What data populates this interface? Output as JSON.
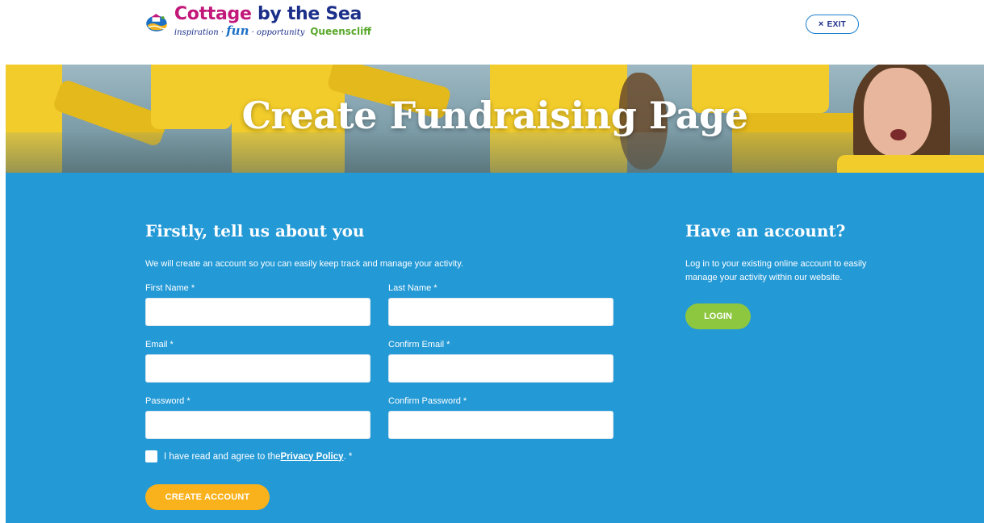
{
  "header": {
    "logo_title_part1": "Cottage",
    "logo_title_part2": "by the Sea",
    "logo_tag_1": "inspiration · ",
    "logo_tag_fun": "fun",
    "logo_tag_2": " · opportunity",
    "logo_place": "Queenscliff",
    "exit_icon": "×",
    "exit_label": "EXIT"
  },
  "hero": {
    "title": "Create Fundraising Page"
  },
  "form": {
    "heading": "Firstly, tell us about you",
    "intro": "We will create an account so you can easily keep track and manage your activity.",
    "first_name_label": "First Name *",
    "last_name_label": "Last Name *",
    "email_label": "Email *",
    "confirm_email_label": "Confirm Email *",
    "password_label": "Password *",
    "confirm_password_label": "Confirm Password *",
    "first_name_value": "",
    "last_name_value": "",
    "email_value": "",
    "confirm_email_value": "",
    "password_value": "",
    "confirm_password_value": "",
    "privacy_text": "I have read and agree to the ",
    "privacy_link": "Privacy Policy",
    "privacy_suffix": ". *",
    "privacy_checked": false,
    "create_button": "CREATE ACCOUNT"
  },
  "account": {
    "heading": "Have an account?",
    "text": "Log in to your existing online account to easily manage your activity within our website.",
    "login_button": "LOGIN"
  },
  "colors": {
    "main_blue": "#2399d6",
    "create_button": "#f9b21b",
    "login_button": "#8dc63f"
  }
}
